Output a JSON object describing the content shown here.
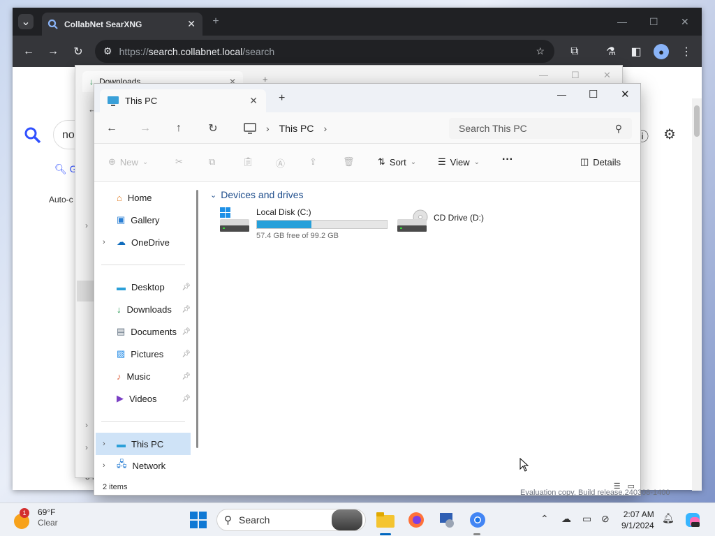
{
  "browser": {
    "tab_title": "CollabNet SearXNG",
    "url_scheme": "https://",
    "url_host": "search.collabnet.local",
    "url_path": "/search",
    "page": {
      "query_partial": "no",
      "tab_label": "G",
      "autocomplete": "Auto-c",
      "footer_partial": "5 i"
    }
  },
  "downloads_window": {
    "tab_title": "Downloads"
  },
  "explorer": {
    "tab_title": "This PC",
    "breadcrumb": "This PC",
    "search_placeholder": "Search This PC",
    "toolbar": {
      "new_label": "New",
      "sort_label": "Sort",
      "view_label": "View",
      "more_label": "···",
      "details_label": "Details"
    },
    "sidebar": [
      {
        "label": "Home",
        "icon": "home-icon",
        "expand": false,
        "pin": false
      },
      {
        "label": "Gallery",
        "icon": "gallery-icon",
        "expand": false,
        "pin": false
      },
      {
        "label": "OneDrive",
        "icon": "onedrive-icon",
        "expand": true,
        "pin": false
      },
      {
        "label": "Desktop",
        "icon": "desktop-icon",
        "expand": false,
        "pin": true
      },
      {
        "label": "Downloads",
        "icon": "downloads-icon",
        "expand": false,
        "pin": true
      },
      {
        "label": "Documents",
        "icon": "documents-icon",
        "expand": false,
        "pin": true
      },
      {
        "label": "Pictures",
        "icon": "pictures-icon",
        "expand": false,
        "pin": true
      },
      {
        "label": "Music",
        "icon": "music-icon",
        "expand": false,
        "pin": true
      },
      {
        "label": "Videos",
        "icon": "videos-icon",
        "expand": false,
        "pin": true
      },
      {
        "label": "This PC",
        "icon": "this-pc-icon",
        "expand": true,
        "pin": false
      },
      {
        "label": "Network",
        "icon": "network-icon",
        "expand": true,
        "pin": false
      }
    ],
    "group_header": "Devices and drives",
    "drives": [
      {
        "name": "Local Disk (C:)",
        "free_text": "57.4 GB free of 99.2 GB",
        "used_fraction": 0.42
      },
      {
        "name": "CD Drive (D:)"
      }
    ],
    "status_items": "2 items"
  },
  "taskbar": {
    "weather_temp": "69°F",
    "weather_desc": "Clear",
    "weather_badge": "1",
    "search_label": "Search",
    "time": "2:07 AM",
    "date": "9/1/2024"
  },
  "watermark": "Evaluation copy. Build release.240308-1400",
  "colors": {
    "accent": "#0067c0",
    "drive_fill": "#26a0da",
    "selected": "#cfe3f7"
  }
}
